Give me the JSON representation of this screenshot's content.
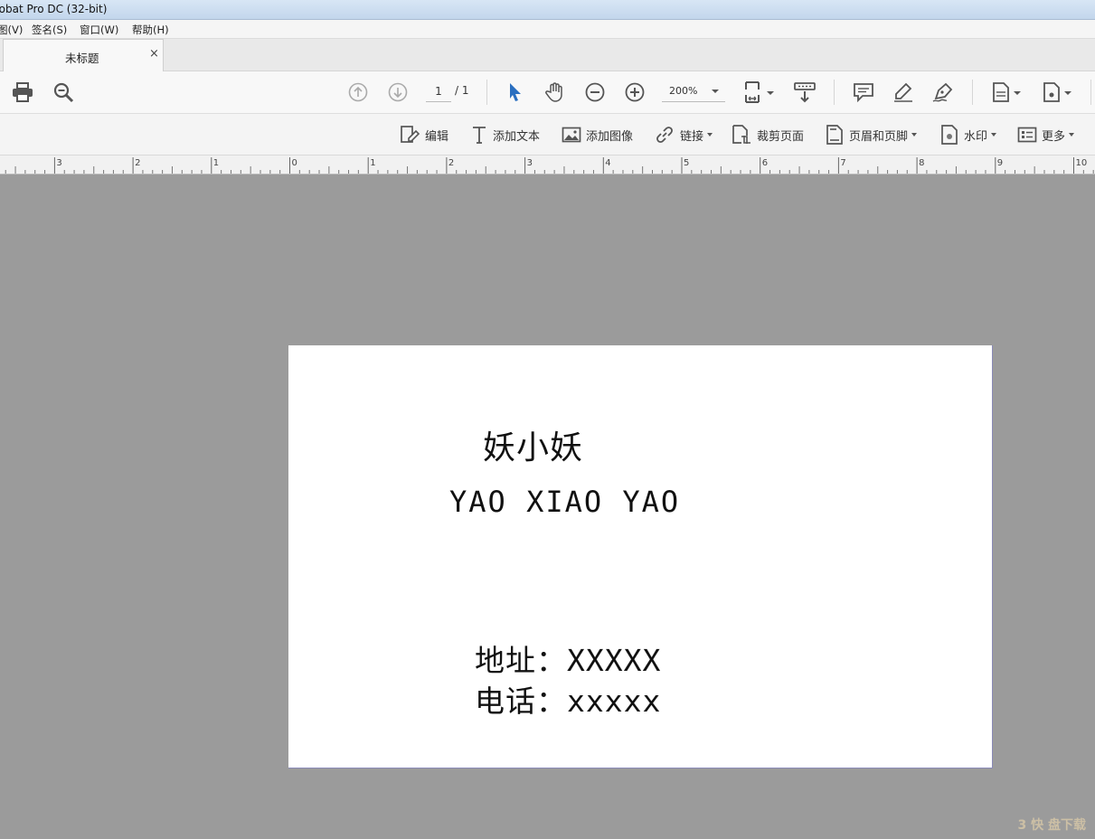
{
  "window": {
    "title": "robat Pro DC (32-bit)"
  },
  "menu": [
    "图(V)",
    "签名(S)",
    "窗口(W)",
    "帮助(H)"
  ],
  "tab": {
    "label": "未标题",
    "close": "×"
  },
  "toolbar": {
    "page_current": "1",
    "page_total": "/ 1",
    "zoom": "200%"
  },
  "edit_toolbar": {
    "edit": "编辑",
    "add_text": "添加文本",
    "add_image": "添加图像",
    "link": "链接",
    "crop": "裁剪页面",
    "header_footer": "页眉和页脚",
    "watermark": "水印",
    "more": "更多"
  },
  "ruler": {
    "labels": [
      "3",
      "2",
      "1",
      "0",
      "1",
      "2",
      "3",
      "4",
      "5",
      "6",
      "7",
      "8",
      "9",
      "10"
    ]
  },
  "document": {
    "name_cn": "妖小妖",
    "name_en": "YAO XIAO YAO",
    "address_label": "地址：",
    "address_value": "XXXXX",
    "phone_label": "电话：",
    "phone_value": "xxxxx"
  },
  "corner_watermark": "3 快 盘下载"
}
